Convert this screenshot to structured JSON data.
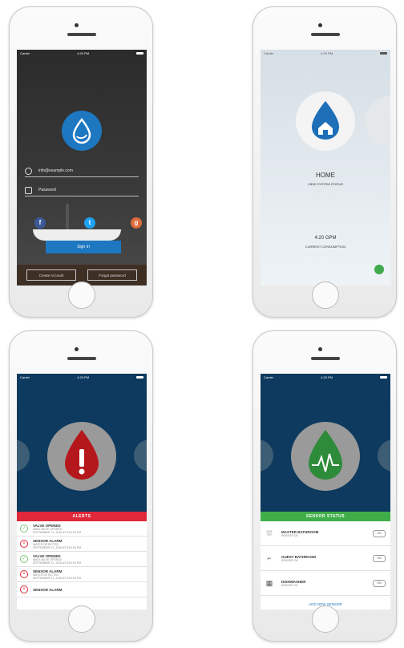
{
  "login_screen": {
    "email_value": "info@example.com",
    "password_placeholder": "Password",
    "social": [
      {
        "name": "facebook",
        "glyph": "f",
        "color": "#3b5998"
      },
      {
        "name": "twitter",
        "glyph": "t",
        "color": "#1da1f2"
      },
      {
        "name": "google",
        "glyph": "g",
        "color": "#dd6b3b"
      }
    ],
    "sign_in_label": "Sign In",
    "create_account_label": "Create Account",
    "forgot_password_label": "Forgot password"
  },
  "home_screen": {
    "title": "HOME",
    "subtitle": "VIEW SYSTEM STATUS",
    "time": "4:20 GPM",
    "consumption_label": "CURRENT CONSUMPTION"
  },
  "alerts_screen": {
    "header": "ALERTS",
    "accent": "#e0283a",
    "items": [
      {
        "title": "VALVE OPENED",
        "detail": "MAIN VALVE OPENED",
        "date": "SEPTEMBER 21, 2016 AT 8:00:00 PM",
        "status": "ok"
      },
      {
        "title": "SENSOR ALARM",
        "detail": "WATER DETECTED",
        "date": "SEPTEMBER 21, 2016 AT 8:00:00 PM",
        "status": "alarm"
      },
      {
        "title": "VALVE OPENED",
        "detail": "MAIN VALVE OPENED",
        "date": "SEPTEMBER 21, 2016 AT 8:00:00 PM",
        "status": "ok"
      },
      {
        "title": "SENSOR ALARM",
        "detail": "WATER DETECTED",
        "date": "SEPTEMBER 21, 2016 AT 8:00:00 PM",
        "status": "alarm"
      },
      {
        "title": "SENSOR ALARM",
        "detail": "",
        "date": "",
        "status": "alarm"
      }
    ]
  },
  "sensor_screen": {
    "header": "SENSOR STATUS",
    "accent": "#3fae49",
    "items": [
      {
        "title": "MASTER BATHROOM",
        "status": "SENSOR OK",
        "toggle": "ON"
      },
      {
        "title": "GUEST BATHROOM",
        "status": "SENSOR OK",
        "toggle": "ON"
      },
      {
        "title": "DISHWASHER",
        "status": "SENSOR OK",
        "toggle": "ON"
      }
    ],
    "add_label": "ADD NEW SENSOR"
  },
  "status_bar": {
    "carrier": "Carrier",
    "time": "4:20 PM"
  }
}
